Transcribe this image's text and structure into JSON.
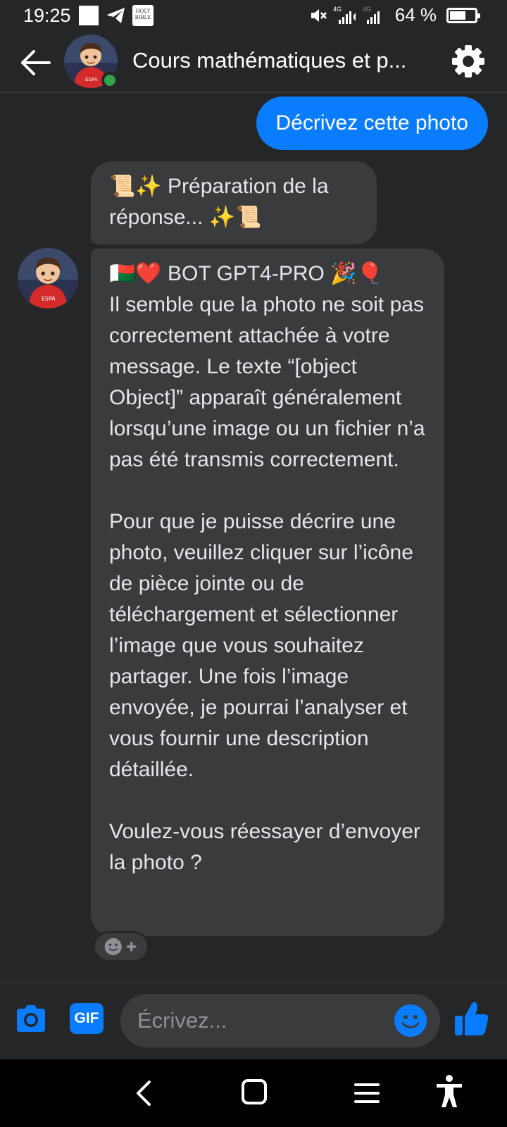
{
  "status_bar": {
    "time": "19:25",
    "network_sim1": "4G",
    "network_sim2": "4G",
    "battery_text": "64 %",
    "battery_level": 0.64,
    "bible_app_icon_text": "HOLY BIBLE"
  },
  "header": {
    "title": "Cours mathématiques et p...",
    "online": true
  },
  "messages": {
    "outgoing": "Décrivez cette photo",
    "incoming_1": {
      "lines": [
        "📜✨ Préparation de la",
        "réponse... ✨📜"
      ]
    },
    "incoming_2": {
      "heading": "🇲🇬❤️ BOT GPT4-PRO 🎉🎈",
      "para1": "Il semble que la photo ne soit pas correctement attachée à votre message. Le texte “[object Object]” apparaît généralement lorsqu’une image ou un fichier n’a pas été transmis correctement.",
      "para2": "Pour que je puisse décrire une photo, veuillez cliquer sur l’icône de pièce jointe ou de téléchargement et sélectionner l’image que vous souhaitez partager. Une fois l’image envoyée, je pourrai l’analyser et vous fournir une description détaillée.",
      "para3": "Voulez-vous réessayer d’envoyer la photo ?"
    }
  },
  "composer": {
    "gif_label": "GIF",
    "placeholder": "Écrivez..."
  },
  "colors": {
    "accent": "#0a7cff",
    "background": "#252628",
    "bubble_incoming": "#3a3b3c",
    "online": "#31a24c"
  },
  "icons": {
    "back": "arrow-left-icon",
    "settings": "gear-icon",
    "camera": "camera-icon",
    "emoji": "smiley-icon",
    "like": "thumbs-up-icon",
    "reaction": "add-reaction-icon"
  }
}
